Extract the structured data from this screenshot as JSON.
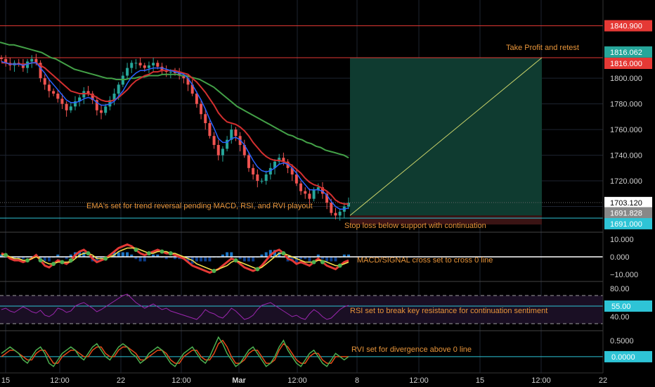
{
  "chart_data": {
    "type": "line",
    "colors": {
      "background": "#000000",
      "grid": "#1e2430",
      "candle_up": "#26a69a",
      "candle_down": "#ef5350",
      "ema_fast": "#2962ff",
      "ema_mid": "#d32f2f",
      "ema_slow": "#43a047",
      "resistance_line": "#e53935",
      "support_line": "#2ec4d6",
      "profit_zone": "#0f3b30",
      "loss_zone": "#3b1414",
      "annotation": "#e8953a",
      "rsi_line": "#9c27b0",
      "rvi_line_1": "#4caf50",
      "rvi_line_2": "#e64a19"
    },
    "x_tick_labels": [
      "15",
      "12:00",
      "22",
      "12:00",
      "Mar",
      "12:00",
      "8",
      "12:00",
      "15",
      "12:00",
      "22"
    ],
    "price_axis": {
      "range": [
        1680,
        1850
      ],
      "ticks": [
        "1800.000",
        "1780.000",
        "1760.000",
        "1740.000",
        "1720.000",
        "1700.000"
      ],
      "tags": [
        {
          "label": "1840.900",
          "value": 1840.9,
          "color": "#e53935"
        },
        {
          "label": "1816.062",
          "value": 1816.062,
          "color": "#26a69a"
        },
        {
          "label": "1816.000",
          "value": 1816.0,
          "color": "#e53935"
        },
        {
          "label": "1703.120",
          "value": 1703.12,
          "color": "#ffffff"
        },
        {
          "label": "1691.828",
          "value": 1691.828,
          "color": "#888888"
        },
        {
          "label": "1691.000",
          "value": 1691.0,
          "color": "#2ec4d6"
        }
      ],
      "horizontal_lines": [
        1840.9,
        1816.0,
        1691.0
      ],
      "trade_box": {
        "entry": 1693.0,
        "target": 1816.0,
        "stop": 1686.0
      },
      "series": [
        {
          "role": "candles_close",
          "values": [
            1815,
            1812,
            1810,
            1812,
            1811,
            1808,
            1813,
            1815,
            1812,
            1800,
            1795,
            1790,
            1788,
            1784,
            1780,
            1775,
            1778,
            1782,
            1785,
            1790,
            1788,
            1783,
            1775,
            1773,
            1778,
            1783,
            1788,
            1795,
            1802,
            1808,
            1812,
            1812,
            1810,
            1808,
            1810,
            1812,
            1809,
            1806,
            1805,
            1805,
            1804,
            1802,
            1800,
            1795,
            1788,
            1780,
            1772,
            1765,
            1755,
            1748,
            1740,
            1745,
            1752,
            1760,
            1755,
            1748,
            1740,
            1730,
            1725,
            1720,
            1720,
            1725,
            1730,
            1735,
            1738,
            1735,
            1730,
            1725,
            1718,
            1712,
            1710,
            1706,
            1713,
            1715,
            1710,
            1703,
            1695,
            1693,
            1696,
            1700,
            1703
          ]
        },
        {
          "role": "ema_fast",
          "values": [
            1813,
            1812,
            1811,
            1811,
            1811,
            1810,
            1811,
            1812,
            1812,
            1808,
            1804,
            1799,
            1795,
            1791,
            1787,
            1783,
            1781,
            1781,
            1782,
            1784,
            1785,
            1784,
            1781,
            1779,
            1779,
            1780,
            1782,
            1786,
            1790,
            1796,
            1801,
            1804,
            1806,
            1806,
            1807,
            1808,
            1808,
            1808,
            1807,
            1806,
            1805,
            1804,
            1803,
            1800,
            1795,
            1789,
            1783,
            1776,
            1768,
            1761,
            1753,
            1750,
            1750,
            1753,
            1754,
            1752,
            1748,
            1742,
            1736,
            1731,
            1728,
            1727,
            1728,
            1730,
            1733,
            1734,
            1733,
            1730,
            1726,
            1721,
            1717,
            1713,
            1713,
            1713,
            1712,
            1709,
            1704,
            1700,
            1698,
            1698,
            1699
          ]
        },
        {
          "role": "ema_mid",
          "values": [
            1812,
            1812,
            1811,
            1811,
            1811,
            1811,
            1811,
            1812,
            1812,
            1810,
            1808,
            1805,
            1802,
            1799,
            1796,
            1793,
            1790,
            1789,
            1788,
            1788,
            1788,
            1787,
            1785,
            1783,
            1782,
            1782,
            1783,
            1785,
            1788,
            1791,
            1795,
            1798,
            1800,
            1802,
            1803,
            1805,
            1805,
            1806,
            1806,
            1806,
            1806,
            1805,
            1804,
            1803,
            1800,
            1797,
            1793,
            1789,
            1784,
            1779,
            1773,
            1769,
            1766,
            1765,
            1764,
            1762,
            1759,
            1755,
            1750,
            1746,
            1742,
            1739,
            1737,
            1736,
            1736,
            1735,
            1734,
            1732,
            1729,
            1726,
            1722,
            1719,
            1717,
            1716,
            1714,
            1712,
            1709,
            1705,
            1703,
            1702,
            1702
          ]
        },
        {
          "role": "ema_slow",
          "values": [
            1828,
            1827,
            1826,
            1826,
            1825,
            1824,
            1823,
            1822,
            1821,
            1820,
            1818,
            1816,
            1815,
            1813,
            1811,
            1809,
            1807,
            1806,
            1805,
            1804,
            1803,
            1802,
            1801,
            1800,
            1800,
            1799,
            1799,
            1799,
            1800,
            1800,
            1801,
            1801,
            1802,
            1802,
            1802,
            1803,
            1803,
            1803,
            1803,
            1802,
            1802,
            1801,
            1800,
            1799,
            1797,
            1795,
            1793,
            1790,
            1787,
            1784,
            1781,
            1778,
            1776,
            1774,
            1772,
            1770,
            1768,
            1766,
            1764,
            1762,
            1760,
            1758,
            1756,
            1755,
            1753,
            1752,
            1750,
            1749,
            1747,
            1746,
            1744,
            1743,
            1742,
            1741,
            1740,
            1738
          ]
        }
      ]
    },
    "macd_panel": {
      "ticks": [
        "10.000",
        "0.000",
        "−10.000"
      ],
      "range": [
        -14,
        14
      ],
      "zero_line": 0,
      "macd": [
        2,
        1,
        -1,
        -2,
        -2,
        -3,
        -2,
        -1,
        1,
        -2,
        -5,
        -6,
        -4,
        -2,
        -3,
        -4,
        -2,
        1,
        3,
        4,
        2,
        -1,
        -3,
        -2,
        -1,
        1,
        3,
        5,
        6,
        7,
        6,
        4,
        2,
        1,
        2,
        3,
        4,
        3,
        2,
        2,
        1,
        0,
        -1,
        -3,
        -5,
        -6,
        -7,
        -8,
        -9,
        -8,
        -7,
        -5,
        -3,
        -1,
        -2,
        -4,
        -6,
        -7,
        -8,
        -7,
        -5,
        -2,
        1,
        3,
        4,
        2,
        -1,
        -2,
        -4,
        -3,
        -4,
        -5,
        -3,
        -1,
        -3,
        -5,
        -6,
        -7,
        -5,
        -3,
        -2
      ],
      "signal": [
        1,
        1,
        0,
        -1,
        -1,
        -2,
        -2,
        -1,
        0,
        -1,
        -3,
        -4,
        -4,
        -3,
        -3,
        -3,
        -3,
        -1,
        1,
        2,
        2,
        1,
        -1,
        -1,
        -1,
        0,
        1,
        3,
        4,
        5,
        5,
        5,
        4,
        3,
        2,
        2,
        3,
        3,
        3,
        2,
        2,
        1,
        0,
        -1,
        -2,
        -4,
        -5,
        -6,
        -7,
        -8,
        -7,
        -6,
        -5,
        -3,
        -2,
        -3,
        -4,
        -5,
        -6,
        -7,
        -6,
        -4,
        -2,
        0,
        2,
        2,
        1,
        0,
        -1,
        -2,
        -3,
        -3,
        -3,
        -2,
        -2,
        -3,
        -4,
        -5,
        -5,
        -4,
        -3
      ]
    },
    "rsi_panel": {
      "ticks": [
        "80.00",
        "40.00"
      ],
      "range": [
        20,
        90
      ],
      "bands": [
        70,
        30
      ],
      "level": {
        "label": "55.00",
        "value": 55
      },
      "values": [
        50,
        52,
        48,
        46,
        50,
        54,
        51,
        47,
        45,
        49,
        42,
        40,
        44,
        52,
        50,
        46,
        48,
        55,
        58,
        60,
        56,
        52,
        47,
        50,
        54,
        58,
        62,
        66,
        70,
        72,
        66,
        60,
        56,
        52,
        55,
        58,
        54,
        50,
        52,
        48,
        46,
        44,
        42,
        40,
        38,
        36,
        42,
        50,
        46,
        44,
        40,
        38,
        44,
        52,
        48,
        42,
        36,
        38,
        42,
        50,
        56,
        58,
        60,
        56,
        52,
        48,
        44,
        40,
        42,
        38,
        36,
        44,
        50,
        46,
        40,
        36,
        38,
        44,
        50,
        54,
        56
      ]
    },
    "rvi_panel": {
      "ticks": [
        "0.5000"
      ],
      "range": [
        -0.5,
        0.8
      ],
      "level": {
        "label": "0.0000",
        "value": 0
      },
      "line1": [
        0.1,
        0.2,
        0.3,
        0.2,
        0.1,
        -0.1,
        -0.2,
        0.0,
        0.2,
        0.3,
        0.1,
        -0.2,
        -0.3,
        -0.1,
        0.1,
        0.2,
        0.3,
        0.2,
        0.0,
        -0.1,
        0.1,
        0.3,
        0.4,
        0.2,
        0.0,
        -0.1,
        0.1,
        0.3,
        0.4,
        0.3,
        0.1,
        0.0,
        -0.2,
        -0.1,
        0.1,
        0.2,
        0.3,
        0.2,
        0.0,
        -0.2,
        -0.3,
        -0.1,
        0.1,
        0.2,
        0.3,
        0.1,
        -0.1,
        -0.2,
        0.0,
        0.3,
        0.6,
        0.4,
        0.1,
        -0.1,
        -0.3,
        -0.2,
        0.0,
        0.2,
        0.3,
        0.1,
        -0.1,
        -0.3,
        -0.2,
        0.0,
        0.3,
        0.5,
        0.2,
        0.0,
        -0.2,
        -0.3,
        -0.1,
        0.1,
        0.2,
        0.0,
        -0.2,
        -0.3,
        -0.1,
        0.1,
        0.0,
        -0.1,
        0.0
      ],
      "line2": [
        0.0,
        0.1,
        0.2,
        0.2,
        0.1,
        0.0,
        -0.1,
        -0.1,
        0.1,
        0.2,
        0.2,
        0.0,
        -0.2,
        -0.2,
        0.0,
        0.1,
        0.2,
        0.2,
        0.1,
        0.0,
        0.0,
        0.2,
        0.3,
        0.3,
        0.1,
        0.0,
        0.0,
        0.2,
        0.3,
        0.3,
        0.2,
        0.1,
        -0.1,
        -0.1,
        0.0,
        0.1,
        0.2,
        0.2,
        0.1,
        -0.1,
        -0.2,
        -0.2,
        0.0,
        0.1,
        0.2,
        0.2,
        0.0,
        -0.1,
        -0.1,
        0.1,
        0.4,
        0.5,
        0.3,
        0.0,
        -0.2,
        -0.2,
        -0.1,
        0.1,
        0.2,
        0.2,
        0.0,
        -0.2,
        -0.2,
        -0.1,
        0.2,
        0.4,
        0.3,
        0.1,
        -0.1,
        -0.2,
        -0.2,
        0.0,
        0.1,
        0.1,
        -0.1,
        -0.2,
        -0.2,
        0.0,
        0.0,
        0.0,
        0.0
      ]
    },
    "annotations": {
      "take_profit": "Take Profit and retest",
      "ema_note": "EMA's set for trend reversal pending MACD, RSI, and RVI playout",
      "stop_loss": "Stop loss below support with continuation",
      "macd_note": "MACD/SIGNAL cross set to cross 0 line",
      "rsi_note": "RSI set to break key resistance for continuation sentiment",
      "rvi_note": "RVI set for divergence above 0 line"
    }
  }
}
